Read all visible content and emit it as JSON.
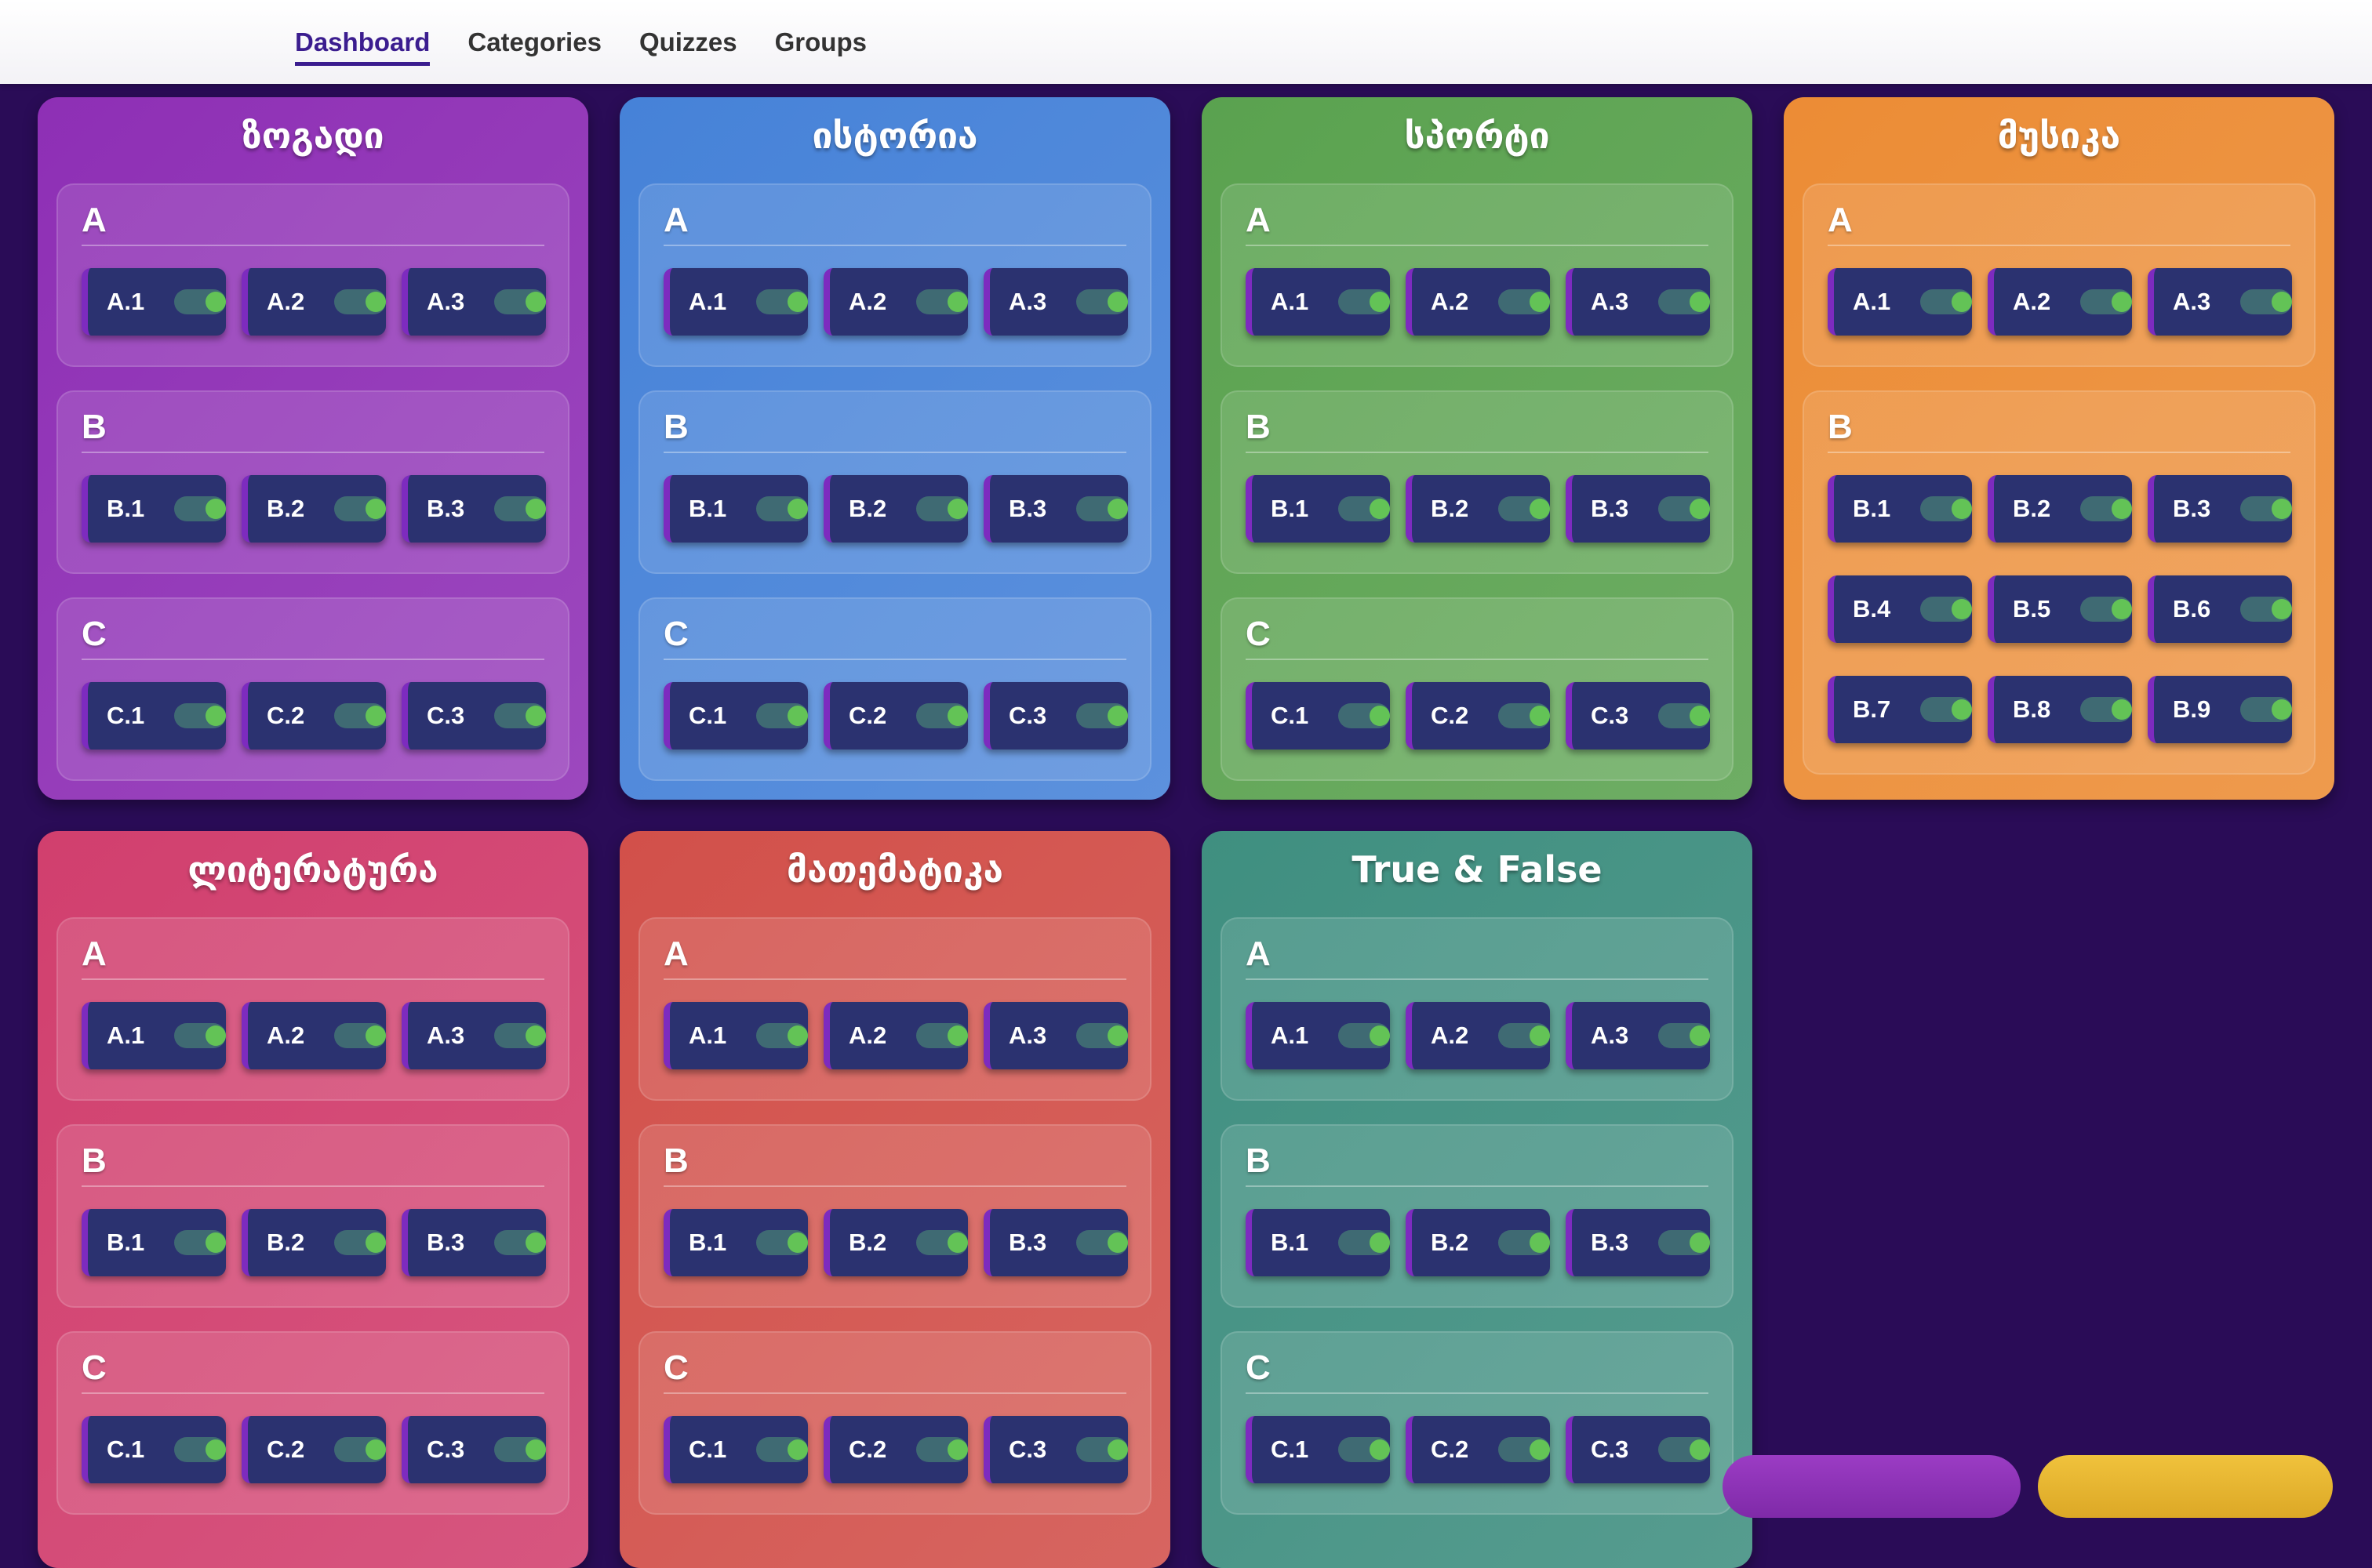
{
  "nav": {
    "tabs": [
      "Dashboard",
      "Categories",
      "Quizzes",
      "Groups"
    ],
    "active": "Dashboard"
  },
  "categories": [
    {
      "title": "ზოგადი",
      "color": "#8e2fb5",
      "sections": [
        {
          "name": "A",
          "items": [
            "A.1",
            "A.2",
            "A.3"
          ]
        },
        {
          "name": "B",
          "items": [
            "B.1",
            "B.2",
            "B.3"
          ]
        },
        {
          "name": "C",
          "items": [
            "C.1",
            "C.2",
            "C.3"
          ]
        }
      ]
    },
    {
      "title": "ისტორია",
      "color": "#4682d8",
      "sections": [
        {
          "name": "A",
          "items": [
            "A.1",
            "A.2",
            "A.3"
          ]
        },
        {
          "name": "B",
          "items": [
            "B.1",
            "B.2",
            "B.3"
          ]
        },
        {
          "name": "C",
          "items": [
            "C.1",
            "C.2",
            "C.3"
          ]
        }
      ]
    },
    {
      "title": "სპორტი",
      "color": "#5aa24f",
      "sections": [
        {
          "name": "A",
          "items": [
            "A.1",
            "A.2",
            "A.3"
          ]
        },
        {
          "name": "B",
          "items": [
            "B.1",
            "B.2",
            "B.3"
          ]
        },
        {
          "name": "C",
          "items": [
            "C.1",
            "C.2",
            "C.3"
          ]
        }
      ]
    },
    {
      "title": "მუსიკა",
      "color": "#ec8c35",
      "sections": [
        {
          "name": "A",
          "items": [
            "A.1",
            "A.2",
            "A.3"
          ]
        },
        {
          "name": "B",
          "items": [
            "B.1",
            "B.2",
            "B.3",
            "B.4",
            "B.5",
            "B.6",
            "B.7",
            "B.8",
            "B.9"
          ]
        }
      ]
    },
    {
      "title": "ლიტერატურა",
      "color": "#d13f6e",
      "sections": [
        {
          "name": "A",
          "items": [
            "A.1",
            "A.2",
            "A.3"
          ]
        },
        {
          "name": "B",
          "items": [
            "B.1",
            "B.2",
            "B.3"
          ]
        },
        {
          "name": "C",
          "items": [
            "C.1",
            "C.2",
            "C.3"
          ]
        }
      ]
    },
    {
      "title": "მათემატიკა",
      "color": "#d2504a",
      "sections": [
        {
          "name": "A",
          "items": [
            "A.1",
            "A.2",
            "A.3"
          ]
        },
        {
          "name": "B",
          "items": [
            "B.1",
            "B.2",
            "B.3"
          ]
        },
        {
          "name": "C",
          "items": [
            "C.1",
            "C.2",
            "C.3"
          ]
        }
      ]
    },
    {
      "title": "True & False",
      "color": "#3f8f80",
      "sections": [
        {
          "name": "A",
          "items": [
            "A.1",
            "A.2",
            "A.3"
          ]
        },
        {
          "name": "B",
          "items": [
            "B.1",
            "B.2",
            "B.3"
          ]
        },
        {
          "name": "C",
          "items": [
            "C.1",
            "C.2",
            "C.3"
          ]
        }
      ]
    }
  ],
  "colors": {
    "background": "#2a0c57",
    "chip": "#2b3270",
    "chip_accent": "#7d2bbf",
    "toggle_on": "#63c356",
    "nav_active": "#3b1d8f"
  }
}
